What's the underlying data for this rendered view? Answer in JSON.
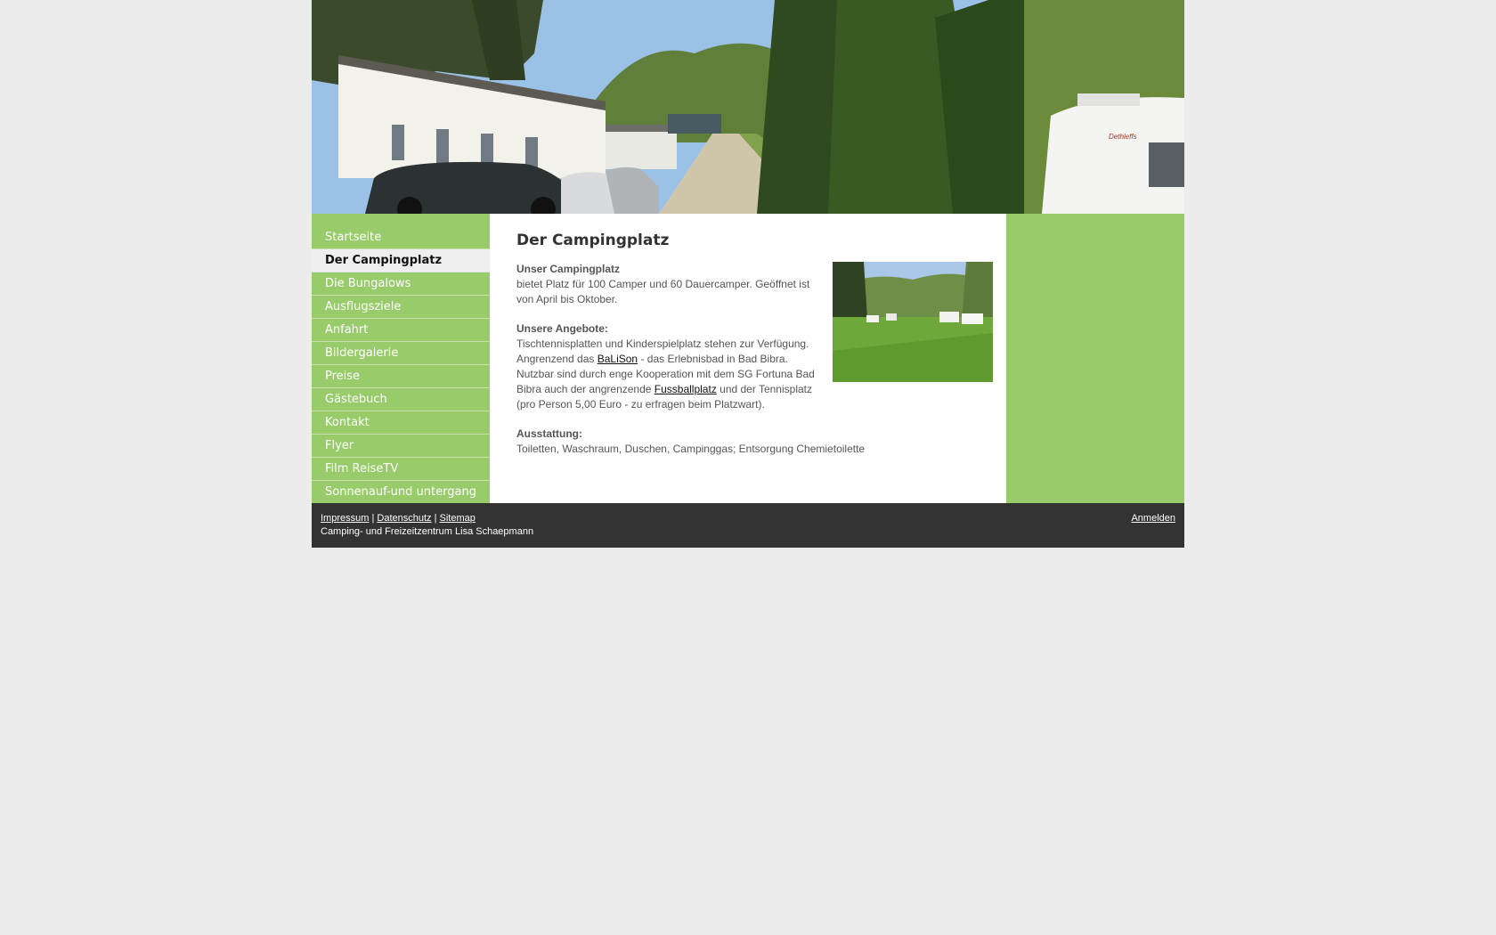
{
  "header": {
    "image": "campground-banner-photo"
  },
  "nav": {
    "items": [
      {
        "label": "Startseite"
      },
      {
        "label": "Der Campingplatz",
        "active": true
      },
      {
        "label": "Die Bungalows"
      },
      {
        "label": "Ausflugsziele"
      },
      {
        "label": "Anfahrt"
      },
      {
        "label": "Bildergalerie"
      },
      {
        "label": "Preise"
      },
      {
        "label": "Gästebuch"
      },
      {
        "label": "Kontakt"
      },
      {
        "label": "Flyer"
      },
      {
        "label": "Film ReiseTV"
      },
      {
        "label": "Sonnenauf-und untergang"
      }
    ]
  },
  "content": {
    "title": "Der Campingplatz",
    "section1": {
      "heading": "Unser Campingplatz",
      "text": "bietet Platz für 100 Camper und 60 Dauercamper. Geöffnet ist von April bis Oktober."
    },
    "section2": {
      "heading": "Unsere Angebote:",
      "line1": "Tischtennisplatten und Kinderspielplatz stehen zur Verfügung.",
      "text_a": "Angrenzend das ",
      "link1": "BaLiSon",
      "text_b": " - das Erlebnisbad in Bad Bibra. Nutzbar sind durch enge Kooperation mit dem SG Fortuna Bad Bibra auch der angrenzende ",
      "link2": "Fussballplatz",
      "text_c": " und der Tennisplatz (pro Person 5,00 Euro - zu erfragen beim Platzwart)."
    },
    "section3": {
      "heading": "Ausstattung:",
      "text": "Toiletten, Waschraum, Duschen, Campinggas; Entsorgung Chemietoilette"
    }
  },
  "footer": {
    "impressum": "Impressum",
    "sep1": " | ",
    "datenschutz": "Datenschutz",
    "sep2": " | ",
    "sitemap": "Sitemap",
    "company": "Camping- und Freizeitzentrum Lisa Schaepmann",
    "login": "Anmelden"
  },
  "colors": {
    "background": "#ececec",
    "nav_green": "#98cc6a",
    "footer": "#333333",
    "active_nav": "#eeeeee"
  }
}
